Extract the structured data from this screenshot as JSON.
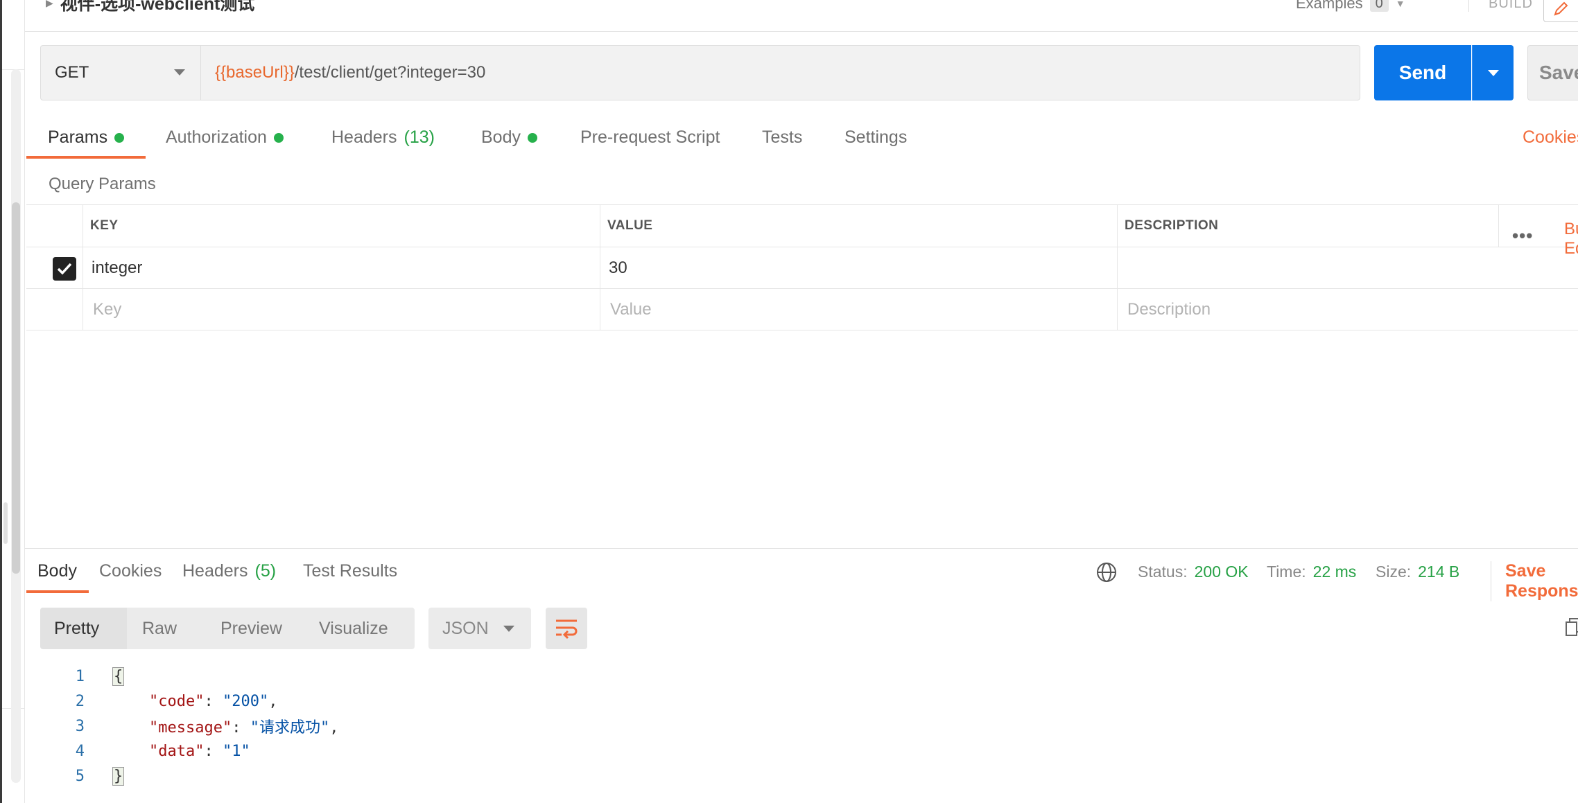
{
  "request": {
    "title": "视伴-选项-webclient测试",
    "examples_label": "Examples",
    "examples_count": "0",
    "build_label": "BUILD",
    "method": "GET",
    "url_variable": "{{baseUrl}}",
    "url_path": "/test/client/get?integer=30",
    "send_label": "Send",
    "save_label": "Save"
  },
  "request_tabs": [
    {
      "label": "Params",
      "dot": true
    },
    {
      "label": "Authorization",
      "dot": true
    },
    {
      "label": "Headers",
      "count": "(13)"
    },
    {
      "label": "Body",
      "dot": true
    },
    {
      "label": "Pre-request Script"
    },
    {
      "label": "Tests"
    },
    {
      "label": "Settings"
    }
  ],
  "cookies_link": "Cookies",
  "query_params": {
    "label": "Query Params",
    "headers": [
      "KEY",
      "VALUE",
      "DESCRIPTION"
    ],
    "bulk_edit": "Bulk Edit",
    "rows": [
      {
        "checked": true,
        "key": "integer",
        "value": "30",
        "description": ""
      }
    ],
    "placeholders": {
      "key": "Key",
      "value": "Value",
      "description": "Description"
    }
  },
  "response_tabs": [
    {
      "label": "Body"
    },
    {
      "label": "Cookies"
    },
    {
      "label": "Headers",
      "count": "(5)"
    },
    {
      "label": "Test Results"
    }
  ],
  "response_meta": {
    "status_label": "Status:",
    "status_value": "200 OK",
    "time_label": "Time:",
    "time_value": "22 ms",
    "size_label": "Size:",
    "size_value": "214 B",
    "save_response": "Save Response"
  },
  "format_tabs": [
    "Pretty",
    "Raw",
    "Preview",
    "Visualize"
  ],
  "format_select": "JSON",
  "code_lines": [
    {
      "n": "1",
      "open": "{"
    },
    {
      "n": "2",
      "key": "\"code\"",
      "value": "\"200\"",
      "trail": ","
    },
    {
      "n": "3",
      "key": "\"message\"",
      "value": "\"请求成功\"",
      "trail": ","
    },
    {
      "n": "4",
      "key": "\"data\"",
      "value": "\"1\"",
      "trail": ""
    },
    {
      "n": "5",
      "close": "}"
    }
  ],
  "colors": {
    "accent": "#f26b3a",
    "send": "#0b76e8",
    "success": "#26a145"
  }
}
